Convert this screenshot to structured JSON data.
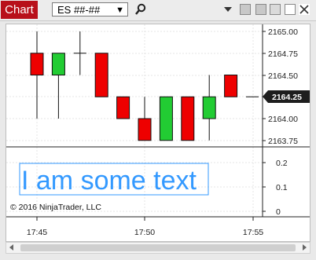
{
  "window": {
    "tab_label": "Chart",
    "instrument": "ES ##-##"
  },
  "price_axis": {
    "ticks": [
      "2165.00",
      "2164.75",
      "2164.50",
      "2164.00",
      "2163.75"
    ],
    "last_price": "2164.25"
  },
  "indicator_axis": {
    "ticks": [
      "0.2",
      "0.1",
      "0"
    ]
  },
  "time_axis": {
    "ticks": [
      "17:45",
      "17:50",
      "17:55"
    ]
  },
  "annotation": {
    "text": "I am some text"
  },
  "copyright": "© 2016 NinjaTrader, LLC",
  "colors": {
    "up": "#22cc33",
    "down": "#ee0000",
    "text_box": "#3399ff",
    "tab": "#b8101a"
  },
  "chart_data": {
    "type": "candlestick",
    "ylim": [
      2163.7,
      2165.05
    ],
    "candles": [
      {
        "open": 2164.75,
        "close": 2164.5,
        "high": 2165.0,
        "low": 2164.0
      },
      {
        "open": 2164.5,
        "close": 2164.75,
        "high": 2164.75,
        "low": 2164.0
      },
      {
        "open": 2164.75,
        "close": 2164.75,
        "high": 2165.0,
        "low": 2164.5
      },
      {
        "open": 2164.75,
        "close": 2164.25,
        "high": 2164.75,
        "low": 2164.25
      },
      {
        "open": 2164.25,
        "close": 2164.0,
        "high": 2164.25,
        "low": 2164.0
      },
      {
        "open": 2164.0,
        "close": 2163.75,
        "high": 2164.25,
        "low": 2163.75
      },
      {
        "open": 2163.75,
        "close": 2164.25,
        "high": 2164.25,
        "low": 2163.75
      },
      {
        "open": 2164.25,
        "close": 2163.75,
        "high": 2164.25,
        "low": 2163.75
      },
      {
        "open": 2164.0,
        "close": 2164.25,
        "high": 2164.5,
        "low": 2163.75
      },
      {
        "open": 2164.5,
        "close": 2164.25,
        "high": 2164.5,
        "low": 2164.25
      },
      {
        "open": 2164.25,
        "close": 2164.25,
        "high": 2164.25,
        "low": 2164.25
      }
    ]
  }
}
